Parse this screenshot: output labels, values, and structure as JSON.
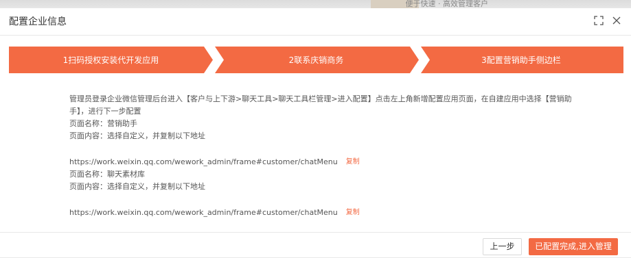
{
  "background": {
    "hint_text": "便于快速 · 高效管理客户"
  },
  "dialog": {
    "title": "配置企业信息",
    "fullscreen_icon": "fullscreen-icon",
    "close_icon": "close-icon"
  },
  "steps": [
    {
      "label": "1扫码授权安装代开发应用"
    },
    {
      "label": "2联系庆销商务"
    },
    {
      "label": "3配置营销助手侧边栏"
    }
  ],
  "instructions": {
    "intro": "管理员登录企业微信管理后台进入【客户与上下游>聊天工具>聊天工具栏管理>进入配置】点击左上角新增配置应用页面，在自建应用中选择【营销助手】，进行下一步配置",
    "items": [
      {
        "page_name": "页面名称：营销助手",
        "page_content": "页面内容：选择自定义，并复制以下地址",
        "url": "https://work.weixin.qq.com/wework_admin/frame#customer/chatMenu",
        "copy_label": "复制"
      },
      {
        "page_name": "页面名称：聊天素材库",
        "page_content": "页面内容：选择自定义，并复制以下地址",
        "url": "https://work.weixin.qq.com/wework_admin/frame#customer/chatMenu",
        "copy_label": "复制"
      }
    ]
  },
  "footer": {
    "prev_label": "上一步",
    "done_label": "已配置完成,进入管理"
  },
  "colors": {
    "accent": "#f36a43",
    "step_fill": "#f36a43"
  }
}
